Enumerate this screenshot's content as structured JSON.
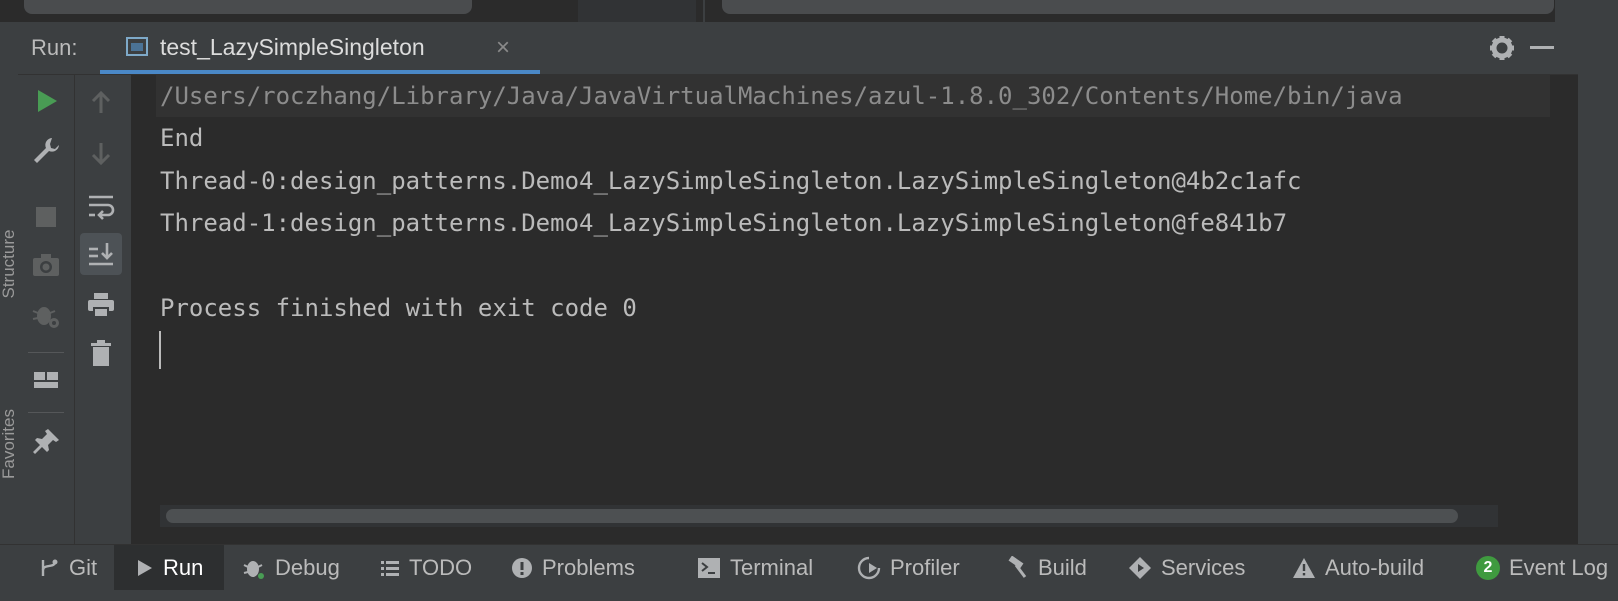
{
  "run_panel": {
    "label": "Run:",
    "tab_title": "test_LazySimpleSingleton",
    "tab_close": "×"
  },
  "side_labels": {
    "structure": "Structure",
    "favorites": "Favorites"
  },
  "console": {
    "lines": [
      "/Users/roczhang/Library/Java/JavaVirtualMachines/azul-1.8.0_302/Contents/Home/bin/java",
      "End",
      "Thread-0:design_patterns.Demo4_LazySimpleSingleton.LazySimpleSingleton@4b2c1afc",
      "Thread-1:design_patterns.Demo4_LazySimpleSingleton.LazySimpleSingleton@fe841b7",
      "",
      "Process finished with exit code 0"
    ]
  },
  "bottom_tabs": [
    {
      "label": "Git",
      "icon": "git-branch-icon"
    },
    {
      "label": "Run",
      "icon": "play-icon",
      "active": true
    },
    {
      "label": "Debug",
      "icon": "bug-icon"
    },
    {
      "label": "TODO",
      "icon": "list-icon"
    },
    {
      "label": "Problems",
      "icon": "warning-circle-icon"
    },
    {
      "label": "Terminal",
      "icon": "terminal-icon"
    },
    {
      "label": "Profiler",
      "icon": "profiler-icon"
    },
    {
      "label": "Build",
      "icon": "hammer-icon"
    },
    {
      "label": "Services",
      "icon": "services-icon"
    },
    {
      "label": "Auto-build",
      "icon": "warning-triangle-icon"
    },
    {
      "label": "Event Log",
      "icon": "event-log-icon",
      "badge": "2"
    }
  ],
  "colors": {
    "accent": "#4a88c7",
    "run_green": "#499c54",
    "console_bg": "#2b2b2b",
    "panel_bg": "#3c3f41"
  }
}
